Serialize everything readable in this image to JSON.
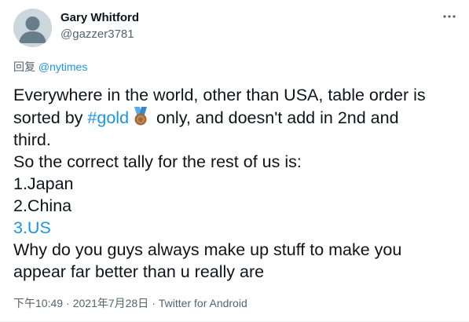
{
  "user": {
    "display_name": "Gary Whitford",
    "handle": "@gazzer3781"
  },
  "reply_to": {
    "prefix": "回复",
    "mention": "@nytimes"
  },
  "tweet": {
    "line1": "Everywhere in the world, other than USA, table order is",
    "line2_before": "sorted by ",
    "hashtag": "#gold",
    "line2_after": " only, and doesn't add in 2nd and",
    "line3": "third.",
    "line4": "So the correct tally for the rest of us is:",
    "line5": "1.Japan",
    "line6": "2.China",
    "line7": "3.US",
    "line8": "Why do you guys always make up stuff to make you",
    "line9": "appear far better than u really are",
    "emoji": "medal-icon"
  },
  "meta": {
    "time": "下午10:49",
    "separator": "·",
    "date": "2021年7月28日",
    "source": "Twitter for Android"
  },
  "colors": {
    "link": "#1b95e0",
    "secondary_text": "#536471",
    "primary_text": "#0f1419",
    "avatar_bg": "#ccd6dd"
  },
  "icons": [
    "default-avatar-icon",
    "more-options-icon",
    "medal-icon"
  ]
}
